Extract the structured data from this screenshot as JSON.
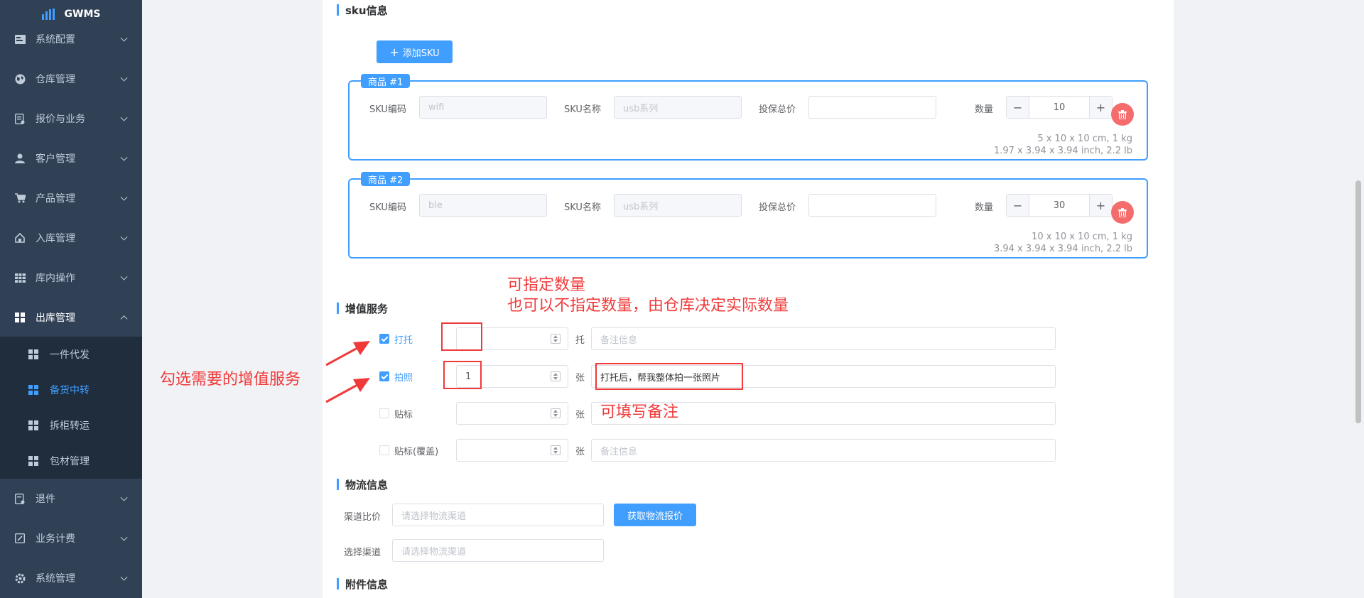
{
  "brand": {
    "name": "GWMS"
  },
  "sidebar": {
    "items": [
      {
        "label": "系统配置",
        "icon": "settings-icon"
      },
      {
        "label": "仓库管理",
        "icon": "globe-icon"
      },
      {
        "label": "报价与业务",
        "icon": "document-icon"
      },
      {
        "label": "客户管理",
        "icon": "user-icon"
      },
      {
        "label": "产品管理",
        "icon": "cart-icon"
      },
      {
        "label": "入库管理",
        "icon": "home-icon"
      },
      {
        "label": "库内操作",
        "icon": "table-icon"
      },
      {
        "label": "出库管理",
        "icon": "grid-icon"
      }
    ],
    "sub_items": [
      {
        "label": "一件代发"
      },
      {
        "label": "备货中转"
      },
      {
        "label": "拆柜转运"
      },
      {
        "label": "包材管理"
      }
    ],
    "bottom_items": [
      {
        "label": "退件",
        "icon": "return-icon"
      },
      {
        "label": "业务计费",
        "icon": "edit-icon"
      },
      {
        "label": "系统管理",
        "icon": "gear-icon"
      }
    ]
  },
  "sku_section": {
    "title": "sku信息",
    "add_button": "添加SKU",
    "field_labels": {
      "code": "SKU编码",
      "name": "SKU名称",
      "insured": "投保总价",
      "qty": "数量"
    },
    "items": [
      {
        "tag": "商品 #1",
        "code": "wifi",
        "name": "usb系列",
        "insured": "",
        "qty": "10",
        "dims_cm": "5 x 10 x 10 cm, 1 kg",
        "dims_in": "1.97 x 3.94 x 3.94 inch, 2.2 lb"
      },
      {
        "tag": "商品 #2",
        "code": "ble",
        "name": "usb系列",
        "insured": "",
        "qty": "30",
        "dims_cm": "10 x 10 x 10 cm, 1 kg",
        "dims_in": "3.94 x 3.94 x 3.94 inch, 2.2 lb"
      }
    ]
  },
  "value_added": {
    "title": "增值服务",
    "services": [
      {
        "label": "打托",
        "checked": true,
        "value": "",
        "unit": "托",
        "remark": "",
        "remark_placeholder": "备注信息"
      },
      {
        "label": "拍照",
        "checked": true,
        "value": "1",
        "unit": "张",
        "remark": "打托后，帮我整体拍一张照片",
        "remark_placeholder": "备注信息"
      },
      {
        "label": "贴标",
        "checked": false,
        "value": "",
        "unit": "张",
        "remark": "",
        "remark_placeholder": ""
      },
      {
        "label": "贴标(覆盖)",
        "checked": false,
        "value": "",
        "unit": "张",
        "remark": "",
        "remark_placeholder": "备注信息"
      }
    ]
  },
  "logistics": {
    "title": "物流信息",
    "compare_label": "渠道比价",
    "compare_placeholder": "请选择物流渠道",
    "quote_button": "获取物流报价",
    "channel_label": "选择渠道",
    "channel_placeholder": "请选择物流渠道"
  },
  "attachments": {
    "title": "附件信息"
  },
  "annotations": {
    "qty_line1": "可指定数量",
    "qty_line2": "也可以不指定数量，由仓库决定实际数量",
    "check_hint": "勾选需要的增值服务",
    "remark_hint": "可填写备注"
  },
  "colors": {
    "sidebar_bg": "#304156",
    "accent": "#409eff",
    "annotation": "#f03a3a",
    "danger": "#f56c6c"
  }
}
